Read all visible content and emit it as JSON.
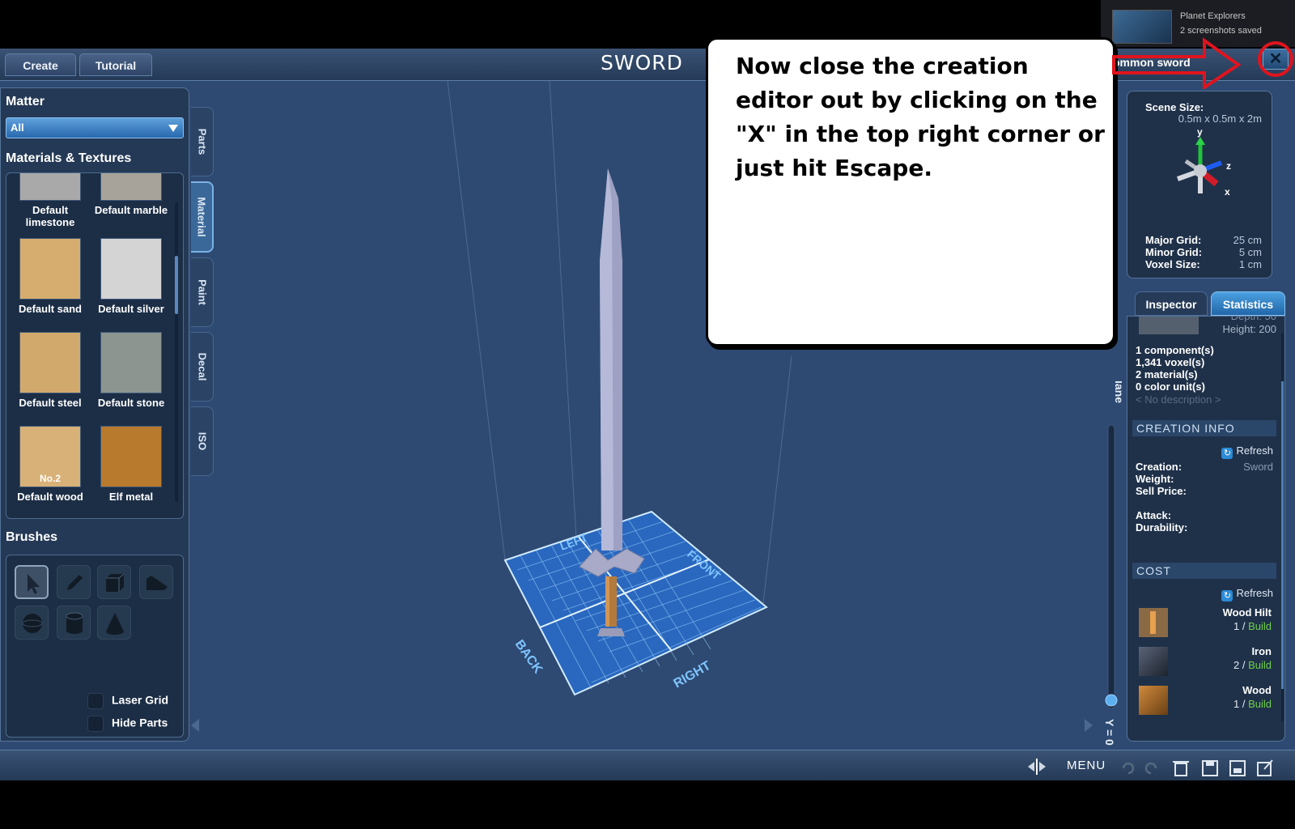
{
  "window": {
    "title": "SWORD",
    "creation_name": "ommon sword",
    "close_label": "✕"
  },
  "tabs": [
    "Create",
    "Tutorial"
  ],
  "left_panel": {
    "matter_label": "Matter",
    "matter_selected": "All",
    "materials_label": "Materials & Textures",
    "materials": [
      {
        "name": "Default limestone",
        "color": "#a9a9a9"
      },
      {
        "name": "Default marble",
        "color": "#a8a39a"
      },
      {
        "name": "Default sand",
        "color": "#d6ad6e"
      },
      {
        "name": "Default silver",
        "color": "#d4d4d4"
      },
      {
        "name": "Default steel",
        "color": "#d2a96c"
      },
      {
        "name": "Default stone",
        "color": "#8c9590"
      },
      {
        "name": "Default wood",
        "color": "#d7b177",
        "swatch_text": "No.2"
      },
      {
        "name": "Elf metal",
        "color": "#b87a2c"
      }
    ],
    "brushes_label": "Brushes",
    "brushes": [
      "select-brush",
      "pencil-brush",
      "box-brush",
      "wedge-brush",
      "sphere-brush",
      "cylinder-brush",
      "cone-brush"
    ],
    "laser_grid_label": "Laser Grid",
    "hide_parts_label": "Hide Parts"
  },
  "side_tabs": [
    "Parts",
    "Material",
    "Paint",
    "Decal",
    "ISO"
  ],
  "viewport": {
    "grid_labels": {
      "left": "LEFT",
      "front": "FRONT",
      "back": "BACK",
      "right": "RIGHT"
    },
    "plane_label": "lane",
    "y_label": "Y = 0"
  },
  "scene": {
    "size_label": "Scene Size:",
    "size_value": "0.5m x 0.5m x 2m",
    "axes": {
      "x": "x",
      "y": "y",
      "z": "z"
    },
    "major_grid_label": "Major Grid:",
    "major_grid_value": "25 cm",
    "minor_grid_label": "Minor Grid:",
    "minor_grid_value": "5 cm",
    "voxel_size_label": "Voxel Size:",
    "voxel_size_value": "1 cm"
  },
  "inspector": {
    "tabs": [
      "Inspector",
      "Statistics"
    ],
    "depth_text": "Depth: 50",
    "height_text": "Height: 200",
    "stats": [
      "1 component(s)",
      "1,341 voxel(s)",
      "2 material(s)",
      "0 color unit(s)"
    ],
    "description": "< No description >",
    "creation_info_header": "CREATION INFO",
    "refresh_label": "Refresh",
    "creation_label": "Creation:",
    "creation_value": "Sword",
    "weight_label": "Weight:",
    "sell_price_label": "Sell Price:",
    "attack_label": "Attack:",
    "durability_label": "Durability:",
    "cost_header": "COST",
    "cost_items": [
      {
        "name": "Wood Hilt",
        "qty": "1 / ",
        "build": "Build"
      },
      {
        "name": "Iron",
        "qty": "2 / ",
        "build": "Build"
      },
      {
        "name": "Wood",
        "qty": "1 / ",
        "build": "Build"
      }
    ]
  },
  "bottom": {
    "menu_label": "MENU"
  },
  "notification": {
    "app": "Planet Explorers",
    "message": "2 screenshots saved"
  },
  "callout": {
    "text": "Now close the creation editor out by clicking on the \"X\" in the top right corner or just hit Escape."
  }
}
